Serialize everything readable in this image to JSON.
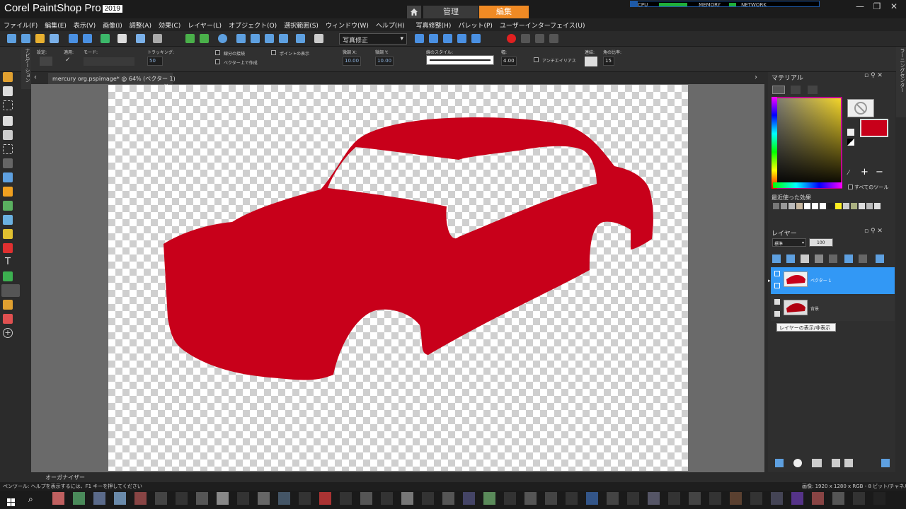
{
  "app": {
    "brand": "Corel PaintShop Pro",
    "year": "2019",
    "tabs": {
      "manage": "管理",
      "edit": "編集"
    },
    "perf": {
      "cpu": "CPU",
      "memory": "MEMORY",
      "network": "NETWORK"
    }
  },
  "menu": [
    "ファイル(F)",
    "編集(E)",
    "表示(V)",
    "画像(I)",
    "調整(A)",
    "効果(C)",
    "レイヤー(L)",
    "オブジェクト(O)",
    "選択範囲(S)",
    "ウィンドウ(W)",
    "ヘルプ(H)",
    "写真修整(H)",
    "パレット(P)",
    "ユーザーインターフェイス(U)"
  ],
  "toolbar": {
    "preset": "写真修正"
  },
  "options": {
    "preset_label": "設定:",
    "apply_label": "適用:",
    "mode_label": "モード:",
    "tracking_label": "トラッキング:",
    "tracking_value": "50",
    "connect_segments": "線分の接続",
    "create_on_vector": "ベクター上で作成",
    "show_nodes": "ポイントの表示",
    "offset_x_label": "微調 X:",
    "offset_x_value": "10.00",
    "offset_y_label": "微調 Y:",
    "offset_y_value": "10.00",
    "line_style_label": "線のスタイル:",
    "width_label": "幅:",
    "width_value": "4.00",
    "antialias": "アンチエイリアス",
    "join_label": "連結:",
    "miter_label": "角の比率:",
    "miter_value": "15"
  },
  "side": {
    "nav": "ナビゲーション",
    "learning": "ラーニングセンター"
  },
  "document": {
    "tab_title": "mercury org.pspimage* @ 64% (ベクター 1)"
  },
  "materials": {
    "title": "マテリアル",
    "all_tools": "すべてのツール",
    "recent_title": "最近使った効果",
    "fg_color": "#c8001a",
    "recent_colors": [
      "#777",
      "#999",
      "#bbb",
      "#c8b8a0",
      "#fff",
      "#fff",
      "#fff",
      "#222",
      "#ffee22",
      "#ccc",
      "#aab080",
      "#ddd",
      "#bbb",
      "#ddd"
    ]
  },
  "layers": {
    "title": "レイヤー",
    "blend_mode": "標準",
    "opacity": "100",
    "items": [
      {
        "name": "ベクター 1",
        "active": true
      },
      {
        "name": "背景",
        "active": false
      }
    ],
    "tooltip": "レイヤーの表示/非表示"
  },
  "organizer": "オーガナイザー",
  "status": {
    "hint": "ペンツール: ヘルプを表示するには、F1 キーを押してください",
    "image_info": "画像: 1920 x 1280 x RGB - 8 ビット/チャネル"
  },
  "taskbar_colors": [
    "#c06060",
    "#4a8a5a",
    "#5a6a8a",
    "#6a8aaa",
    "#884444",
    "#444",
    "#333",
    "#555",
    "#888",
    "#333",
    "#666",
    "#445566",
    "#333",
    "#aa3333",
    "#333",
    "#555",
    "#333",
    "#777",
    "#333",
    "#555",
    "#446",
    "#5a8a5a",
    "#333",
    "#555",
    "#444",
    "#333",
    "#335588",
    "#444",
    "#333",
    "#556",
    "#333",
    "#444",
    "#333",
    "#5a4030",
    "#333",
    "#445",
    "#553388",
    "#884444",
    "#555",
    "#333",
    "#222"
  ]
}
